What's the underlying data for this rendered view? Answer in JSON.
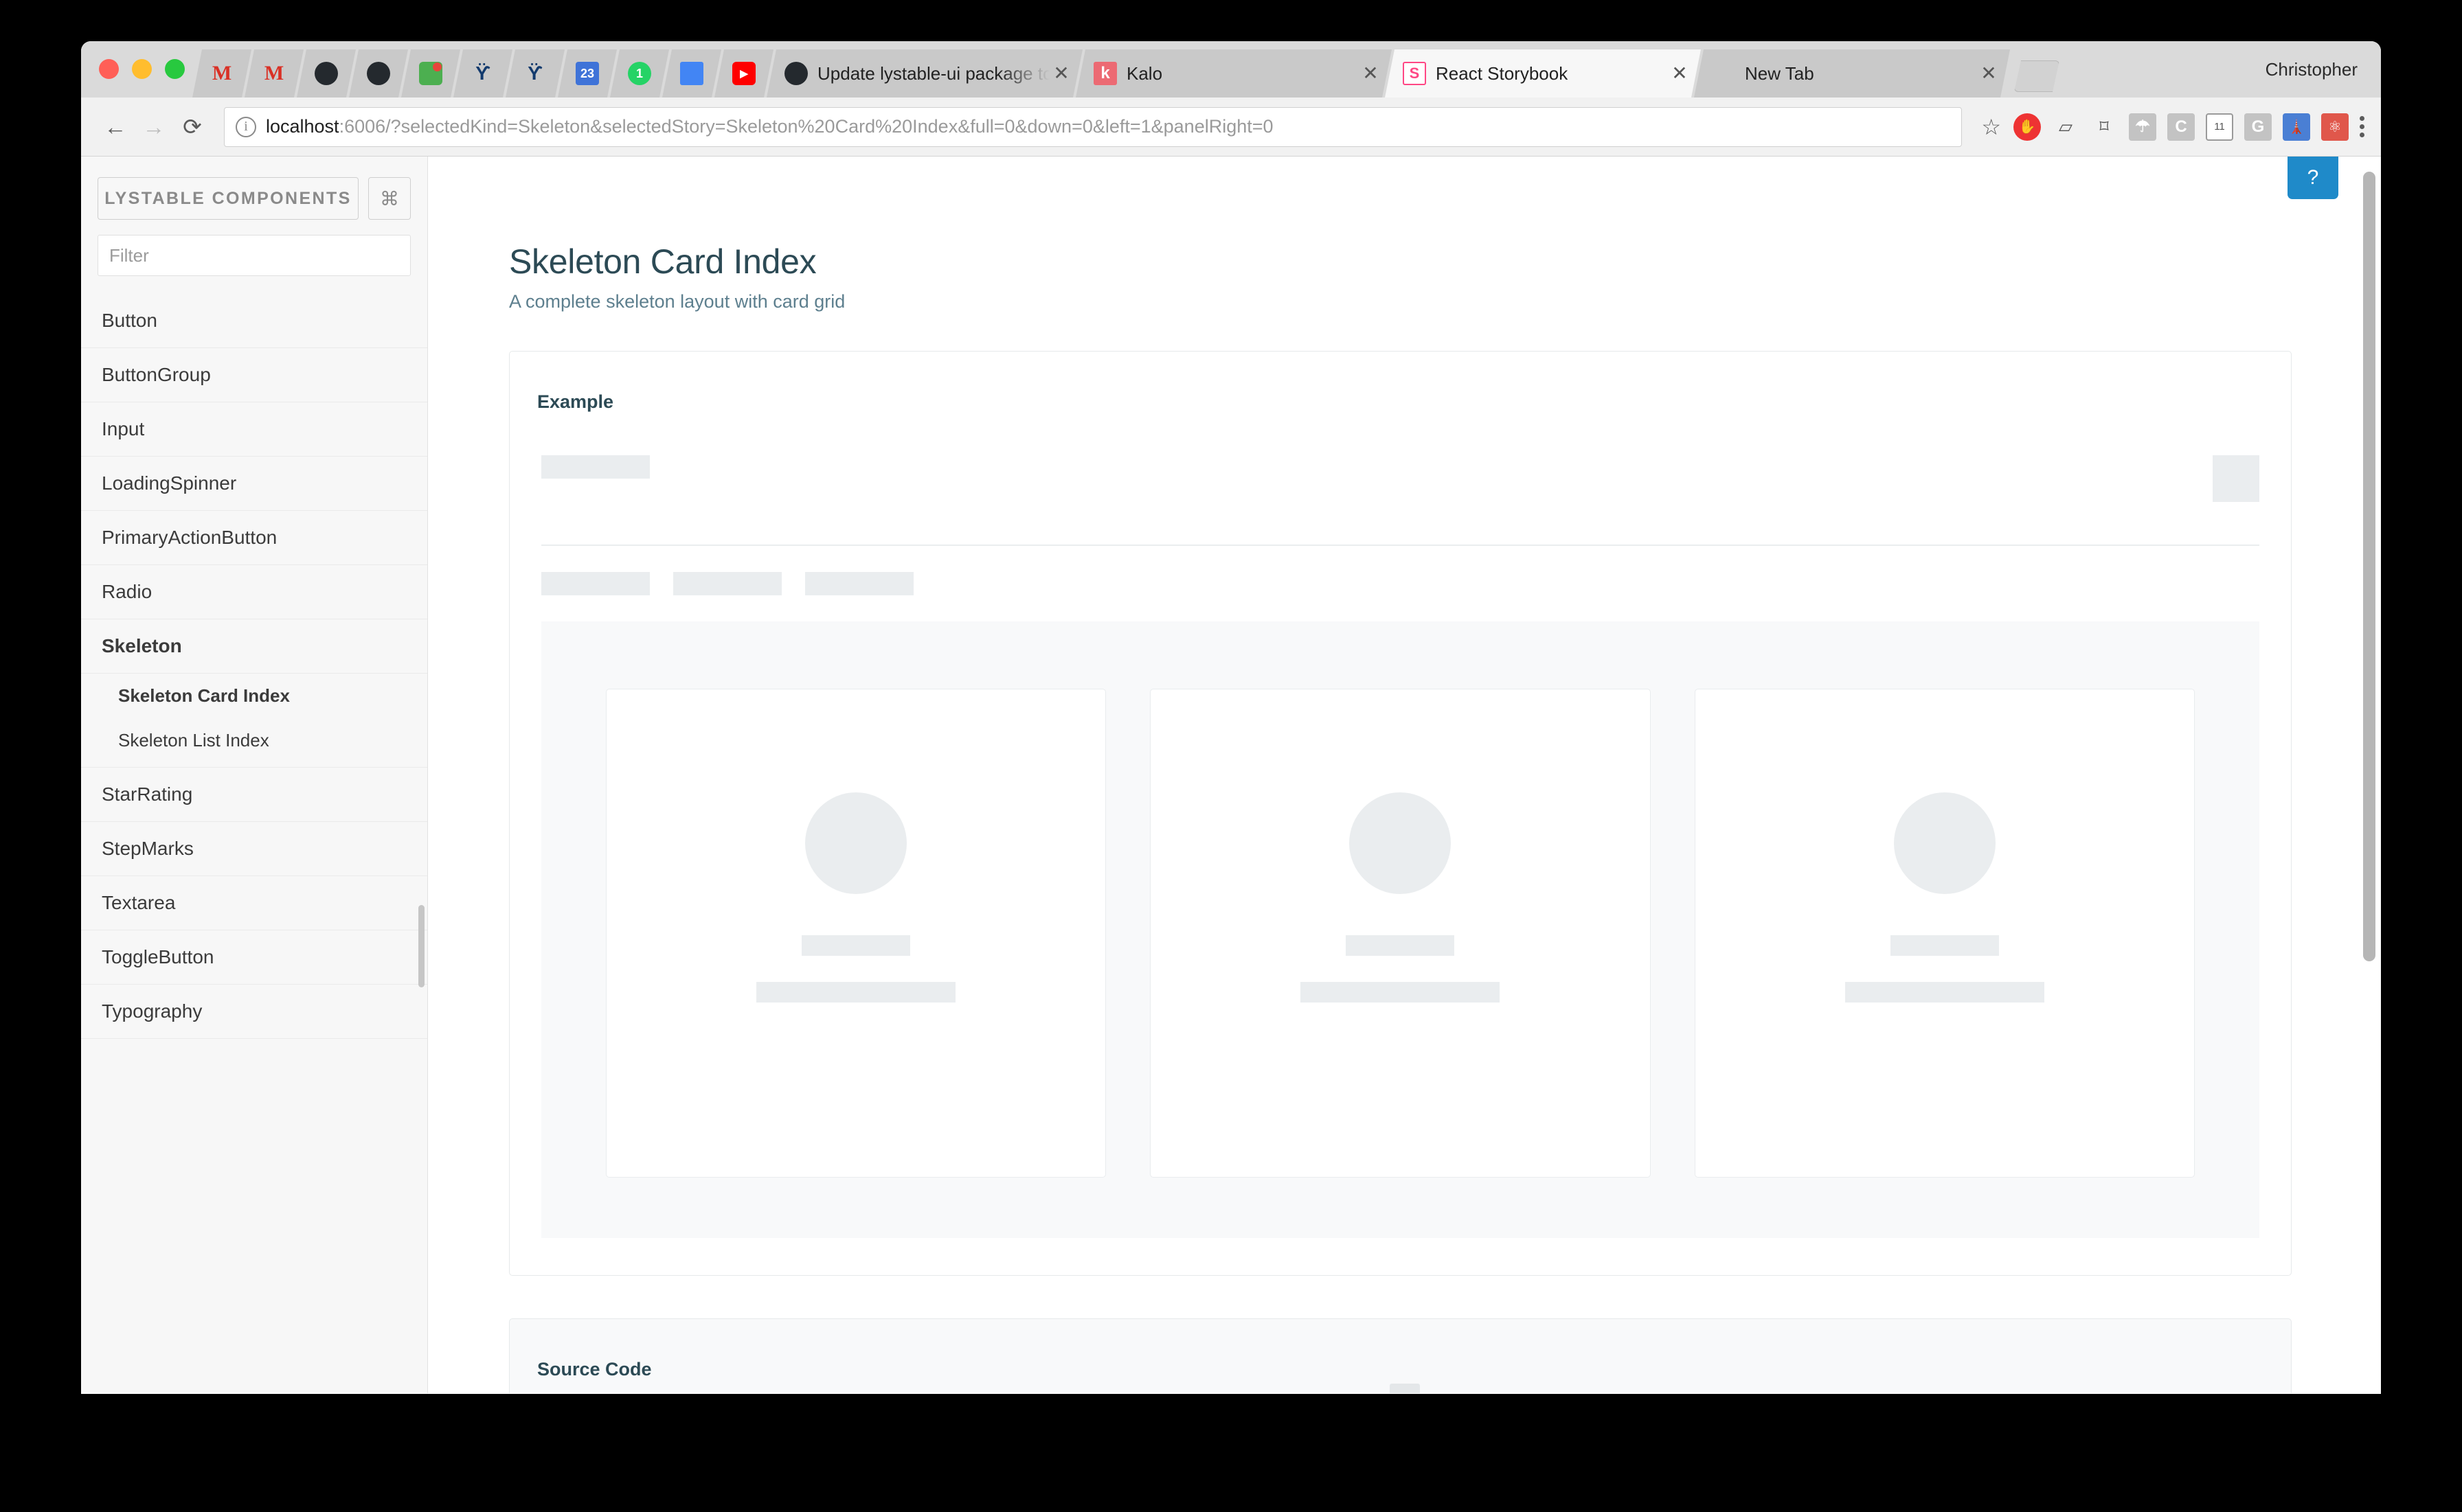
{
  "browser": {
    "profile_name": "Christopher",
    "url_bold": "localhost",
    "url_rest": ":6006/?selectedKind=Skeleton&selectedStory=Skeleton%20Card%20Index&full=0&down=0&left=1&panelRight=0",
    "back_icon": "←",
    "forward_icon": "→",
    "reload_icon": "⟳",
    "info_icon": "i",
    "star_icon": "☆",
    "new_tab_icon": "new-tab",
    "pinned_tabs": [
      {
        "name": "gmail-tab-1",
        "glyph": "M",
        "style": "fav-gmail"
      },
      {
        "name": "gmail-tab-2",
        "glyph": "M",
        "style": "fav-gmail"
      },
      {
        "name": "github-tab-1",
        "glyph": "",
        "style": "fav-github"
      },
      {
        "name": "github-tab-2",
        "glyph": "",
        "style": "fav-github"
      },
      {
        "name": "notes-tab",
        "glyph": "",
        "style": "fav-green"
      },
      {
        "name": "x-tab-1",
        "glyph": "ϔ",
        "style": "fav-x"
      },
      {
        "name": "x-tab-2",
        "glyph": "ϔ",
        "style": "fav-x"
      },
      {
        "name": "calendar-tab",
        "glyph": "23",
        "style": "fav-cal"
      },
      {
        "name": "whatsapp-tab",
        "glyph": "1",
        "style": "fav-whatsapp"
      },
      {
        "name": "google-docs-tab",
        "glyph": "",
        "style": "fav-doc"
      },
      {
        "name": "youtube-tab",
        "glyph": "▶",
        "style": "fav-yt"
      }
    ],
    "tabs": [
      {
        "title": "Update lystable-ui package to",
        "favicon": "",
        "style": "fav-github",
        "active": false,
        "close": "✕"
      },
      {
        "title": "Kalo",
        "favicon": "k",
        "style": "fav-kalo",
        "active": false,
        "close": "✕"
      },
      {
        "title": "React Storybook",
        "favicon": "S",
        "style": "fav-sb",
        "active": true,
        "close": "✕"
      },
      {
        "title": "New Tab",
        "favicon": "",
        "style": "",
        "active": false,
        "close": "✕"
      }
    ],
    "extensions": [
      {
        "name": "adblock-icon",
        "glyph": "✋",
        "style": "ext-adblock"
      },
      {
        "name": "screenshot-icon",
        "glyph": "▱",
        "style": "ext-plain"
      },
      {
        "name": "cast-icon",
        "glyph": "⌑",
        "style": "ext-plain"
      },
      {
        "name": "umbrella-icon",
        "glyph": "☂",
        "style": "ext-grey"
      },
      {
        "name": "c-extension-icon",
        "glyph": "C",
        "style": "ext-grey"
      },
      {
        "name": "tab-count-icon",
        "glyph": "11",
        "style": "ext-win"
      },
      {
        "name": "google-icon",
        "glyph": "G",
        "style": "ext-grey"
      },
      {
        "name": "lighthouse-icon",
        "glyph": "🗼",
        "style": "ext-light"
      },
      {
        "name": "react-devtools-icon",
        "glyph": "⚛",
        "style": "ext-react"
      }
    ]
  },
  "sidebar": {
    "title": "LYSTABLE COMPONENTS",
    "shortcut_glyph": "⌘",
    "filter_placeholder": "Filter",
    "items": [
      {
        "label": "Button",
        "type": "group",
        "selected": false
      },
      {
        "label": "ButtonGroup",
        "type": "group",
        "selected": false
      },
      {
        "label": "Input",
        "type": "group",
        "selected": false
      },
      {
        "label": "LoadingSpinner",
        "type": "group",
        "selected": false
      },
      {
        "label": "PrimaryActionButton",
        "type": "group",
        "selected": false
      },
      {
        "label": "Radio",
        "type": "group",
        "selected": false
      },
      {
        "label": "Skeleton",
        "type": "group",
        "selected": true,
        "children": [
          {
            "label": "Skeleton Card Index",
            "selected": true
          },
          {
            "label": "Skeleton List Index",
            "selected": false
          }
        ]
      },
      {
        "label": "StarRating",
        "type": "group",
        "selected": false
      },
      {
        "label": "StepMarks",
        "type": "group",
        "selected": false
      },
      {
        "label": "Textarea",
        "type": "group",
        "selected": false
      },
      {
        "label": "ToggleButton",
        "type": "group",
        "selected": false
      },
      {
        "label": "Typography",
        "type": "group",
        "selected": false
      }
    ]
  },
  "main": {
    "help_label": "?",
    "story_title": "Skeleton Card Index",
    "story_subtitle": "A complete skeleton layout with card grid",
    "example_label": "Example",
    "source_label": "Source Code",
    "skeleton": {
      "placeholder_color": "#eaedef",
      "card_count": 3,
      "tab_placeholder_count": 3
    },
    "accent_color": "#1f8ac9",
    "heading_color": "#2c4a55",
    "subtitle_color": "#5d7f8e"
  }
}
